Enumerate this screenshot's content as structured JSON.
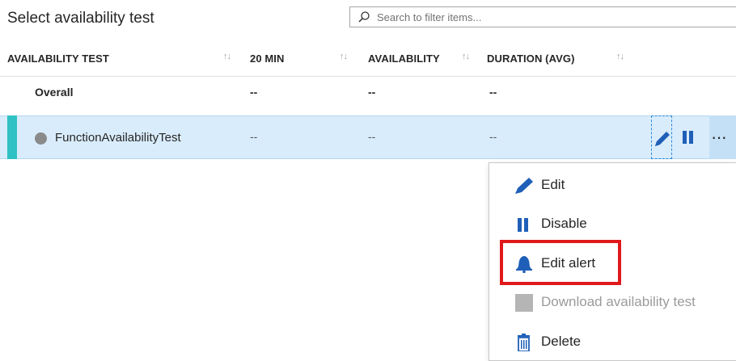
{
  "header": {
    "title": "Select availability test",
    "search_placeholder": "Search to filter items..."
  },
  "columns": [
    {
      "label": "AVAILABILITY TEST",
      "sort": "↑↓"
    },
    {
      "label": "20 MIN",
      "sort": "↑↓"
    },
    {
      "label": "AVAILABILITY",
      "sort": "↑↓"
    },
    {
      "label": "DURATION (AVG)",
      "sort": "↑↓"
    }
  ],
  "overall": {
    "label": "Overall",
    "min20": "--",
    "availability": "--",
    "duration": "--"
  },
  "rows": [
    {
      "name": "FunctionAvailabilityTest",
      "status": "disabled",
      "min20": "--",
      "availability": "--",
      "duration": "--",
      "actions": {
        "edit_icon": "pencil-icon",
        "pause_icon": "pause-icon",
        "more": "···"
      }
    }
  ],
  "context_menu": [
    {
      "label": "Edit",
      "icon": "pencil-icon",
      "enabled": true,
      "highlighted": false
    },
    {
      "label": "Disable",
      "icon": "pause-icon",
      "enabled": true,
      "highlighted": false
    },
    {
      "label": "Edit alert",
      "icon": "bell-icon",
      "enabled": true,
      "highlighted": true
    },
    {
      "label": "Download availability test",
      "icon": "download-icon",
      "enabled": false,
      "highlighted": false
    },
    {
      "label": "Delete",
      "icon": "trash-icon",
      "enabled": true,
      "highlighted": false
    }
  ],
  "colors": {
    "accent_blue": "#1f5fb8",
    "selected_row": "#d9ecfb",
    "row_accent": "#2fc1c3",
    "highlight_border": "#e0191b"
  }
}
